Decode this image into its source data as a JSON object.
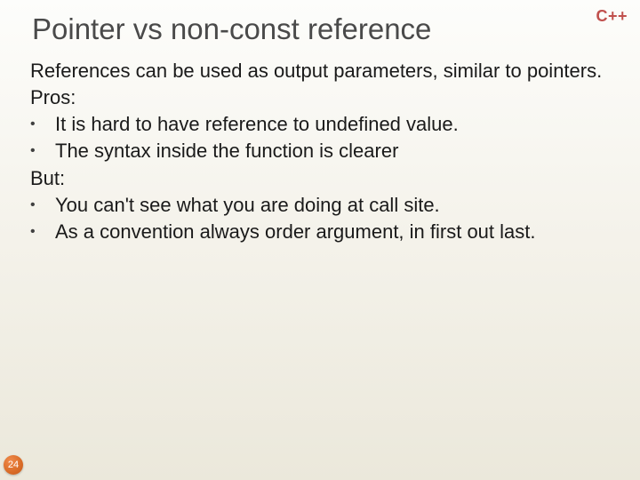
{
  "lang_badge": "C++",
  "title": "Pointer vs non-const reference",
  "intro": "References can be used as output parameters, similar to pointers.",
  "pros_label": "Pros:",
  "pros": [
    "It is hard to have reference to undefined value.",
    "The syntax inside the function is clearer"
  ],
  "but_label": "But:",
  "cons": [
    "You can't see what you are doing at call site.",
    "As a convention always order argument, in first out last."
  ],
  "bullet_char": "•",
  "slide_number": "24"
}
